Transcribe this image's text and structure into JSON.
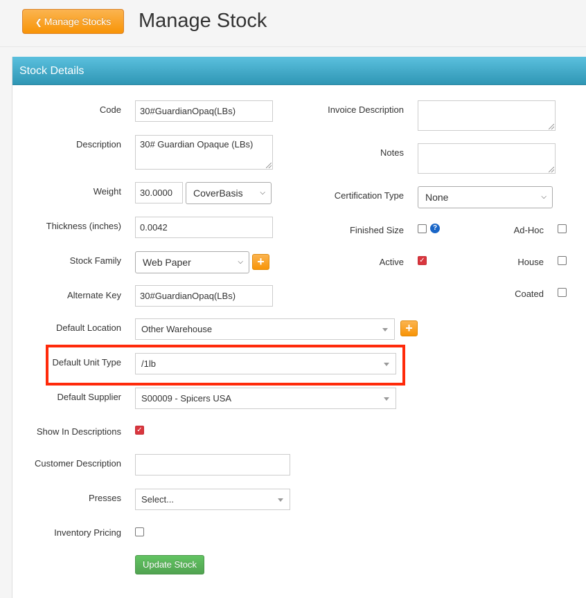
{
  "header": {
    "back_button_label": "Manage Stocks",
    "title": "Manage Stock"
  },
  "panel": {
    "title": "Stock Details"
  },
  "left": {
    "code": {
      "label": "Code",
      "value": "30#GuardianOpaq(LBs)"
    },
    "description": {
      "label": "Description",
      "value": "30# Guardian Opaque (LBs)"
    },
    "weight": {
      "label": "Weight",
      "value": "30.0000",
      "basis": "CoverBasis"
    },
    "thickness": {
      "label": "Thickness (inches)",
      "value": "0.0042"
    },
    "stock_family": {
      "label": "Stock Family",
      "value": "Web Paper"
    },
    "alternate_key": {
      "label": "Alternate Key",
      "value": "30#GuardianOpaq(LBs)"
    },
    "default_location": {
      "label": "Default Location",
      "value": "Other Warehouse"
    },
    "default_unit_type": {
      "label": "Default Unit Type",
      "value": "/1lb"
    },
    "default_supplier": {
      "label": "Default Supplier",
      "value": "S00009 - Spicers USA"
    },
    "show_in_descriptions": {
      "label": "Show In Descriptions",
      "checked": true
    },
    "customer_description": {
      "label": "Customer Description",
      "value": ""
    },
    "presses": {
      "label": "Presses",
      "value": "Select..."
    },
    "inventory_pricing": {
      "label": "Inventory Pricing",
      "checked": false
    }
  },
  "right": {
    "invoice_description": {
      "label": "Invoice Description",
      "value": ""
    },
    "notes": {
      "label": "Notes",
      "value": ""
    },
    "certification_type": {
      "label": "Certification Type",
      "value": "None"
    },
    "finished_size": {
      "label": "Finished Size",
      "checked": false
    },
    "ad_hoc": {
      "label": "Ad-Hoc",
      "checked": false
    },
    "active": {
      "label": "Active",
      "checked": true
    },
    "house": {
      "label": "House",
      "checked": false
    },
    "coated": {
      "label": "Coated",
      "checked": false
    }
  },
  "actions": {
    "update_label": "Update Stock"
  },
  "colors": {
    "accent_orange": "#f89406",
    "header_blue": "#2f96b4",
    "highlight_red": "#ff2a0a",
    "button_green": "#51a351"
  }
}
